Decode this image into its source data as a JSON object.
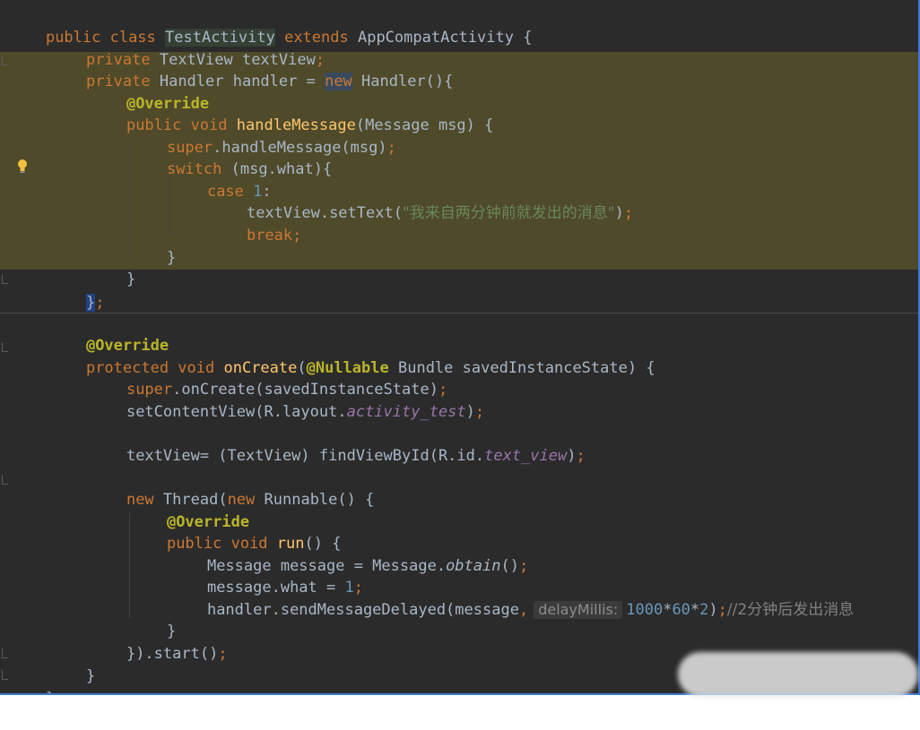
{
  "code": {
    "l1": {
      "a": "public class ",
      "b": "TestActivity",
      "c": " extends ",
      "d": "AppCompatActivity {"
    },
    "l2": {
      "a": "private ",
      "b": "TextView textView",
      "c": ";"
    },
    "l3": {
      "a": "private ",
      "b": "Handler handler = ",
      "c": "new",
      "d": " Handler(){"
    },
    "l4": {
      "a": "@Override"
    },
    "l5": {
      "a": "public void ",
      "b": "handleMessage",
      "c": "(Message msg) {"
    },
    "l6": {
      "a": "super",
      "b": ".handleMessage(msg)",
      "c": ";"
    },
    "l7": {
      "a": "switch",
      "b": " (msg.what){"
    },
    "l8": {
      "a": "case ",
      "b": "1",
      "c": ":"
    },
    "l9": {
      "a": "textView.setText(",
      "b": "\"我来自两分钟前就发出的消息\"",
      "c": ")",
      "d": ";"
    },
    "l10": {
      "a": "break",
      "b": ";"
    },
    "l11": {
      "a": "}"
    },
    "l12": {
      "a": "}"
    },
    "l13": {
      "a": "}",
      "b": ";"
    },
    "l14": {
      "a": "@Override"
    },
    "l15": {
      "a": "protected void ",
      "b": "onCreate",
      "c": "(",
      "d": "@Nullable",
      "e": " Bundle savedInstanceState) {"
    },
    "l16": {
      "a": "super",
      "b": ".onCreate(savedInstanceState)",
      "c": ";"
    },
    "l17": {
      "a": "setContentView(R.layout.",
      "b": "activity_test",
      "c": ")",
      "d": ";"
    },
    "l18": {
      "a": "textView= (TextView) findViewById(R.id.",
      "b": "text_view",
      "c": ")",
      "d": ";"
    },
    "l19": {
      "a": "new ",
      "b": "Thread(",
      "c": "new ",
      "d": "Runnable() {"
    },
    "l20": {
      "a": "@Override"
    },
    "l21": {
      "a": "public void ",
      "b": "run",
      "c": "() {"
    },
    "l22": {
      "a": "Message message = Message.",
      "b": "obtain",
      "c": "()",
      "d": ";"
    },
    "l23": {
      "a": "message.what = ",
      "b": "1",
      "c": ";"
    },
    "l24": {
      "a": "handler.sendMessageDelayed(message",
      "b": ",",
      "hint": "delayMillis:",
      "c": "1000",
      "d": "*",
      "e": "60",
      "f": "*",
      "g": "2",
      "h": ")",
      "i": ";",
      "j": "//2分钟后发出消息"
    },
    "l25": {
      "a": "}"
    },
    "l26": {
      "a": "}).start()",
      "b": ";"
    },
    "l27": {
      "a": "}"
    },
    "l28": {
      "a": "}"
    }
  },
  "icons": {
    "bulb": "lightbulb-icon"
  },
  "colors": {
    "background": "#2b2b2b",
    "keyword": "#cc7832",
    "annotation": "#bbb529",
    "method": "#ffc66d",
    "number": "#6897bb",
    "string": "#6a8759",
    "highlight": "#4e4a2a"
  }
}
